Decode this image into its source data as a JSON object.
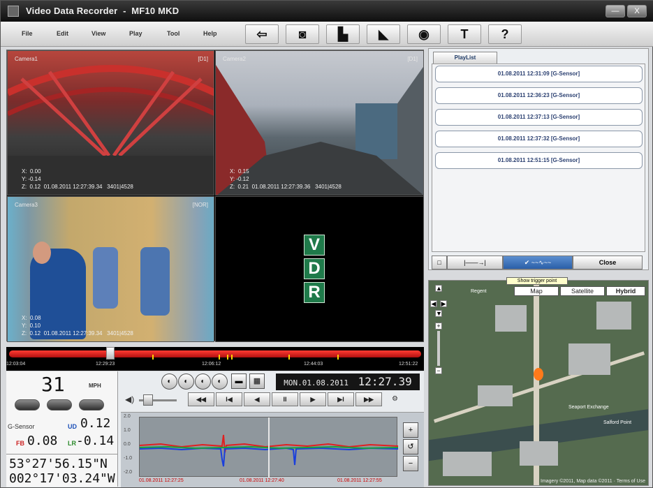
{
  "app": {
    "title": "Video Data Recorder",
    "model": "MF10 MKD",
    "win_buttons": [
      "—",
      "X"
    ]
  },
  "menu": [
    "File",
    "Edit",
    "View",
    "Play",
    "Tool",
    "Help"
  ],
  "toolbar": [
    {
      "icon": "open-folder-icon",
      "glyph": "⇦"
    },
    {
      "icon": "camera-icon",
      "glyph": "◙"
    },
    {
      "icon": "print-icon",
      "glyph": "▙"
    },
    {
      "icon": "clapper-icon",
      "glyph": "◣"
    },
    {
      "icon": "disc-icon",
      "glyph": "◉"
    },
    {
      "icon": "hammer-icon",
      "glyph": "T"
    },
    {
      "icon": "help-icon",
      "glyph": "?"
    }
  ],
  "cameras": [
    {
      "label": "Camera1",
      "res": "[D1]",
      "info": "X:  0.00\nY: -0.14\nZ:  0.12  01.08.2011 12:27:39.34   3401|4528"
    },
    {
      "label": "Camera2",
      "res": "[D1]",
      "info": "X:  0.15\nY: -0.12\nZ:  0.21  01.08.2011 12:27:39.36   3401|4528"
    },
    {
      "label": "Camera3",
      "res": "[NOR]",
      "info": "X:  0.08\nY:  0.10\nZ:  0.12  01.08.2011 12:27:39.34   3401|4528"
    }
  ],
  "vdr_letters": [
    "V",
    "D",
    "R"
  ],
  "timeline": {
    "position": 0.24,
    "ticks": [
      "12:03:04",
      "12:29:23",
      "12:06:12",
      "12:44:03",
      "12:51:22"
    ]
  },
  "speed": {
    "value": "31",
    "unit": "MPH",
    "pills": [
      "",
      "",
      ""
    ]
  },
  "gsensor": {
    "label": "G-Sensor",
    "ud_label": "UD",
    "ud_value": "0.12",
    "fb_label": "FB",
    "fb_value": "0.08",
    "lr_label": "LR",
    "lr_value": "-0.14"
  },
  "gps": {
    "lat": "53°27'56.15\"N",
    "lon": "002°17'03.24\"W"
  },
  "datetime": {
    "date": "MON.01.08.2011",
    "time": "12:27.39"
  },
  "playback": [
    "◀◀",
    "I◀",
    "◀",
    "II",
    "▶",
    "▶I",
    "▶▶"
  ],
  "graph": {
    "yticks": [
      "2.0",
      "1.0",
      "0.0",
      "-1.0",
      "-2.0"
    ],
    "dates": [
      "01.08.2011 12:27:25",
      "01.08.2011 12:27:40",
      "01.08.2011 12:27:55"
    ],
    "side": [
      "+",
      "↺",
      "−"
    ]
  },
  "playlist": {
    "tab": "PlayList",
    "items": [
      "01.08.2011 12:31:09  [G-Sensor]",
      "01.08.2011 12:36:23  [G-Sensor]",
      "01.08.2011 12:37:13  [G-Sensor]",
      "01.08.2011 12:37:32  [G-Sensor]",
      "01.08.2011 12:51:15  [G-Sensor]"
    ],
    "close_label": "Close"
  },
  "tooltip": "Show trigger point",
  "map": {
    "types": [
      "Map",
      "Satellite",
      "Hybrid"
    ],
    "labels": [
      "Regent",
      "Seaport Exchange",
      "Salford Point"
    ],
    "copyright": "Imagery ©2011, Map data ©2011 · Terms of Use"
  }
}
